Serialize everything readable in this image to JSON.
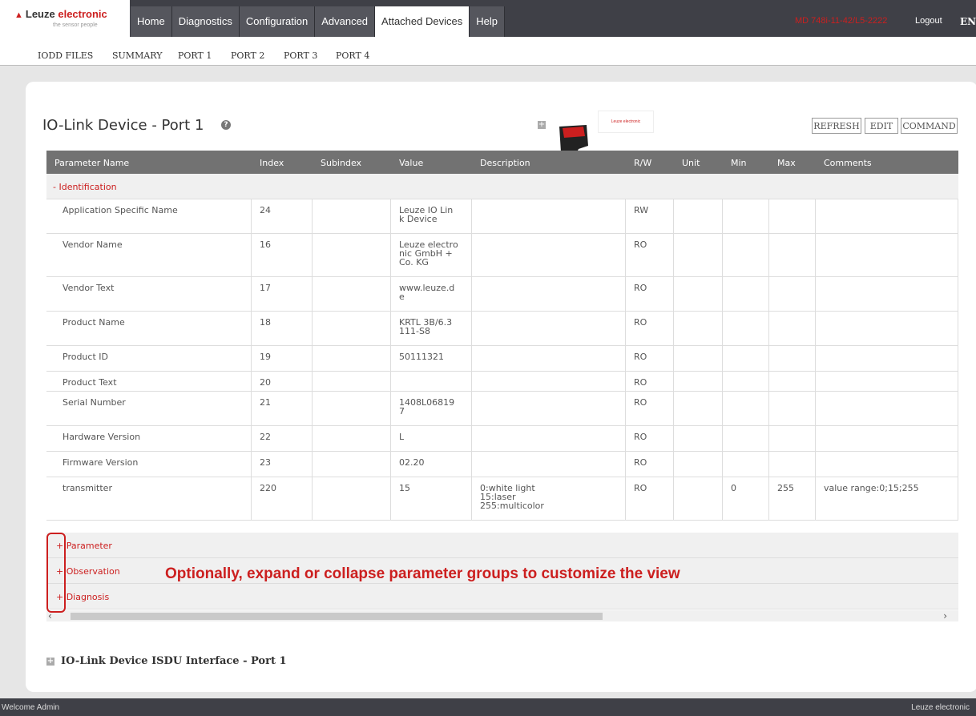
{
  "brand": {
    "name_part1": "Leuze",
    "name_part2": "electronic",
    "tagline": "the sensor people"
  },
  "nav": {
    "tabs": [
      {
        "label": "Home"
      },
      {
        "label": "Diagnostics"
      },
      {
        "label": "Configuration"
      },
      {
        "label": "Advanced"
      },
      {
        "label": "Attached Devices",
        "active": true
      },
      {
        "label": "Help"
      }
    ],
    "device_info": "MD 748i-11-42/L5-2222",
    "logout": "Logout",
    "language": "EN"
  },
  "subnav": {
    "items": [
      "IODD FILES",
      "SUMMARY",
      "PORT 1",
      "PORT 2",
      "PORT 3",
      "PORT 4"
    ]
  },
  "page": {
    "title": "IO-Link Device - Port 1",
    "vendor_logo_text": "Leuze electronic"
  },
  "buttons": {
    "refresh": "REFRESH",
    "edit": "EDIT",
    "command": "COMMAND"
  },
  "table": {
    "headers": [
      "Parameter Name",
      "Index",
      "Subindex",
      "Value",
      "Description",
      "R/W",
      "Unit",
      "Min",
      "Max",
      "Comments"
    ],
    "group_identification": "- Identification",
    "rows": [
      [
        "Application Specific Name",
        "24",
        "",
        "Leuze IO Lin\nk Device",
        "",
        "RW",
        "",
        "",
        "",
        ""
      ],
      [
        "Vendor Name",
        "16",
        "",
        "Leuze electro\nnic GmbH +\nCo. KG",
        "",
        "RO",
        "",
        "",
        "",
        ""
      ],
      [
        "Vendor Text",
        "17",
        "",
        "www.leuze.d\ne",
        "",
        "RO",
        "",
        "",
        "",
        ""
      ],
      [
        "Product Name",
        "18",
        "",
        "KRTL 3B/6.3\n111-S8",
        "",
        "RO",
        "",
        "",
        "",
        ""
      ],
      [
        "Product ID",
        "19",
        "",
        "50111321",
        "",
        "RO",
        "",
        "",
        "",
        ""
      ],
      [
        "Product Text",
        "20",
        "",
        "",
        "",
        "RO",
        "",
        "",
        "",
        ""
      ],
      [
        "Serial Number",
        "21",
        "",
        "1408L06819\n7",
        "",
        "RO",
        "",
        "",
        "",
        ""
      ],
      [
        "Hardware Version",
        "22",
        "",
        "L",
        "",
        "RO",
        "",
        "",
        "",
        ""
      ],
      [
        "Firmware Version",
        "23",
        "",
        "02.20",
        "",
        "RO",
        "",
        "",
        "",
        ""
      ],
      [
        "transmitter",
        "220",
        "",
        "15",
        "0:white light\n15:laser\n255:multicolor",
        "RO",
        "",
        "0",
        "255",
        "value range:0;15;255"
      ]
    ],
    "collapsed_groups": [
      "+ Parameter",
      "+ Observation",
      "+ Diagnosis"
    ]
  },
  "annotation": "Optionally, expand or collapse parameter groups to customize the view",
  "isdu": {
    "label": "IO-Link Device ISDU Interface - Port 1"
  },
  "footer": {
    "welcome": "Welcome Admin",
    "brand": "Leuze electronic"
  },
  "colors": {
    "topbar": "#3f4047",
    "accent_red": "#cc1f1f",
    "table_header": "#727272"
  }
}
